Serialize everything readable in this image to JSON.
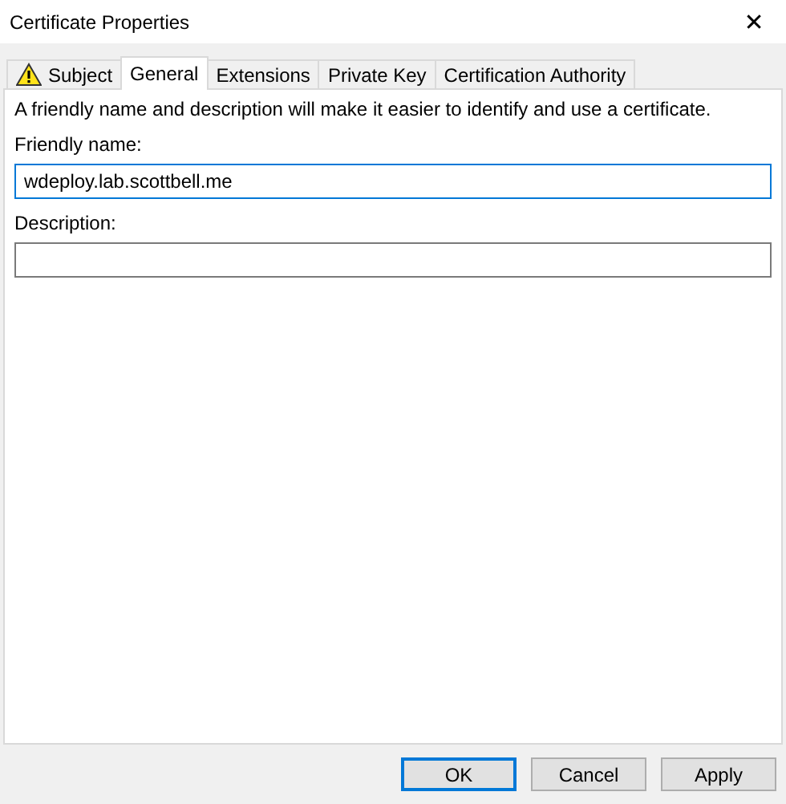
{
  "window": {
    "title": "Certificate Properties",
    "close": "✕"
  },
  "tabs": [
    {
      "label": "Subject",
      "selected": false,
      "warning": true
    },
    {
      "label": "General",
      "selected": true,
      "warning": false
    },
    {
      "label": "Extensions",
      "selected": false,
      "warning": false
    },
    {
      "label": "Private Key",
      "selected": false,
      "warning": false
    },
    {
      "label": "Certification Authority",
      "selected": false,
      "warning": false
    }
  ],
  "intro": "A friendly name and description will make it easier to identify and use a certificate.",
  "fields": [
    {
      "label": "Friendly name:",
      "value": "wdeploy.lab.scottbell.me",
      "focused": true
    },
    {
      "label": "Description:",
      "focused": false
    }
  ],
  "buttons": [
    {
      "label": "OK",
      "default": true
    },
    {
      "label": "Cancel",
      "default": false
    },
    {
      "label": "Apply",
      "default": false
    }
  ]
}
